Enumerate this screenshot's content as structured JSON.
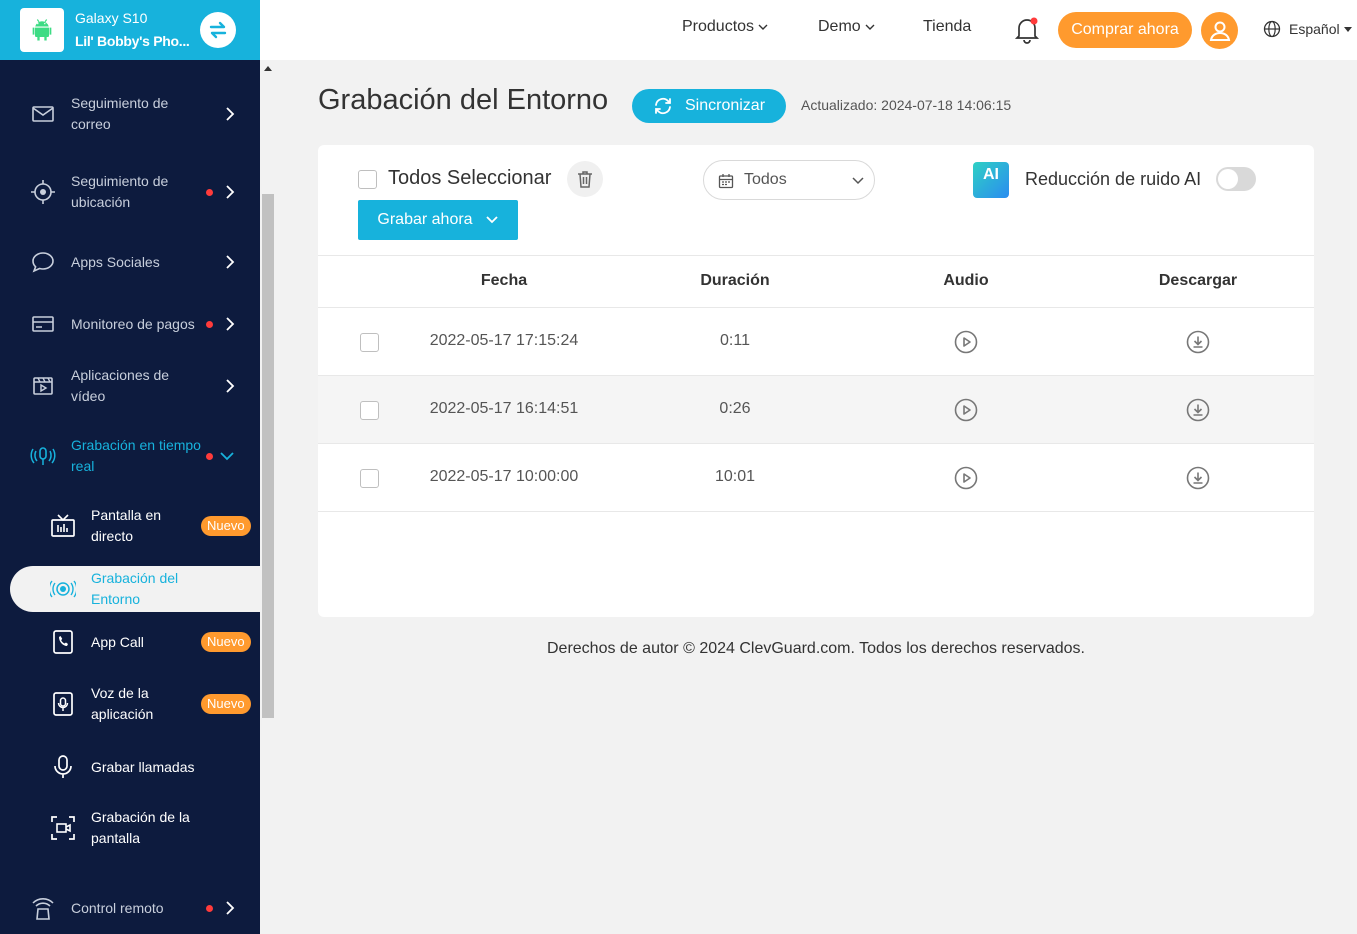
{
  "device": {
    "model": "Galaxy S10",
    "name": "Lil' Bobby's Pho..."
  },
  "sidebar": {
    "items": [
      {
        "label": "Seguimiento de correo",
        "dot": false
      },
      {
        "label": "Seguimiento de ubicación",
        "dot": true
      },
      {
        "label": "Apps Sociales",
        "dot": false
      },
      {
        "label": "Monitoreo de pagos",
        "dot": true
      },
      {
        "label": "Aplicaciones de vídeo",
        "dot": false
      },
      {
        "label": "Grabación en tiempo real",
        "dot": true,
        "expanded": true
      },
      {
        "label": "Control remoto",
        "dot": true
      }
    ],
    "subitems": [
      {
        "label": "Pantalla en directo",
        "badge": "Nuevo"
      },
      {
        "label": "Grabación del Entorno",
        "selected": true
      },
      {
        "label": "App Call",
        "badge": "Nuevo"
      },
      {
        "label": "Voz de la aplicación",
        "badge": "Nuevo"
      },
      {
        "label": "Grabar llamadas"
      },
      {
        "label": "Grabación de la pantalla"
      }
    ]
  },
  "topbar": {
    "products": "Productos",
    "demo": "Demo",
    "store": "Tienda",
    "buy": "Comprar ahora",
    "language": "Español"
  },
  "page": {
    "title": "Grabación del Entorno",
    "sync": "Sincronizar",
    "updated": "Actualizado: 2024-07-18 14:06:15"
  },
  "toolbar": {
    "select_all": "Todos Seleccionar",
    "record_now": "Grabar ahora",
    "filter_value": "Todos",
    "ai_logo": "AI",
    "ai_label": "Reducción de ruido AI"
  },
  "table": {
    "headers": [
      "Fecha",
      "Duración",
      "Audio",
      "Descargar"
    ],
    "rows": [
      {
        "date": "2022-05-17 17:15:24",
        "duration": "0:11"
      },
      {
        "date": "2022-05-17 16:14:51",
        "duration": "0:26"
      },
      {
        "date": "2022-05-17 10:00:00",
        "duration": "10:01"
      }
    ]
  },
  "footer": "Derechos de autor © 2024 ClevGuard.com. Todos los derechos reservados.",
  "colors": {
    "accent": "#17b2dc",
    "orange": "#ff9a2e",
    "sidebar": "#0d1b3e",
    "dot": "#ff3b3b"
  }
}
